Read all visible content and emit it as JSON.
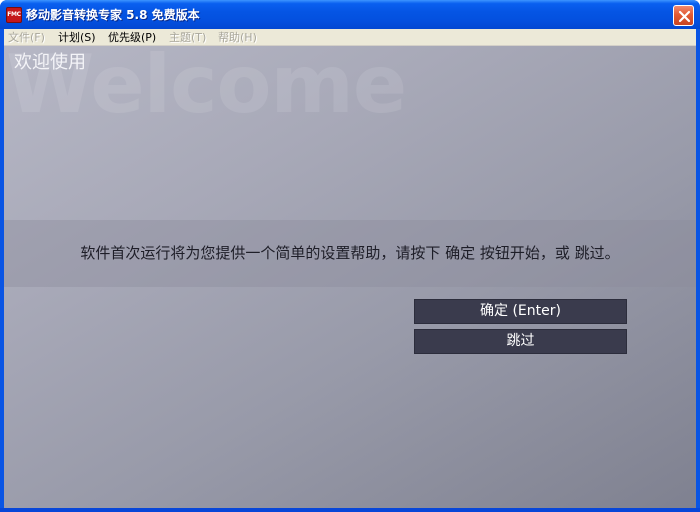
{
  "window": {
    "title": "移动影音转换专家 5.8 免费版本",
    "app_icon_text": "FMC",
    "close_label": "close"
  },
  "menu": {
    "items": [
      {
        "label": "文件(F)",
        "enabled": false
      },
      {
        "label": "计划(S)",
        "enabled": true
      },
      {
        "label": "优先级(P)",
        "enabled": true
      },
      {
        "label": "主题(T)",
        "enabled": false
      },
      {
        "label": "帮助(H)",
        "enabled": false
      }
    ]
  },
  "content": {
    "watermark": "Welcome",
    "heading": "欢迎使用",
    "message": "软件首次运行将为您提供一个简单的设置帮助，请按下 确定 按钮开始，或 跳过。",
    "confirm_button": "确定 (Enter)",
    "skip_button": "跳过"
  },
  "colors": {
    "titlebar": "#0555e4",
    "menubar": "#ece9d8",
    "client_background": "#a8a9b8",
    "button_background": "#3a3b4d",
    "button_text": "#ffffff"
  }
}
